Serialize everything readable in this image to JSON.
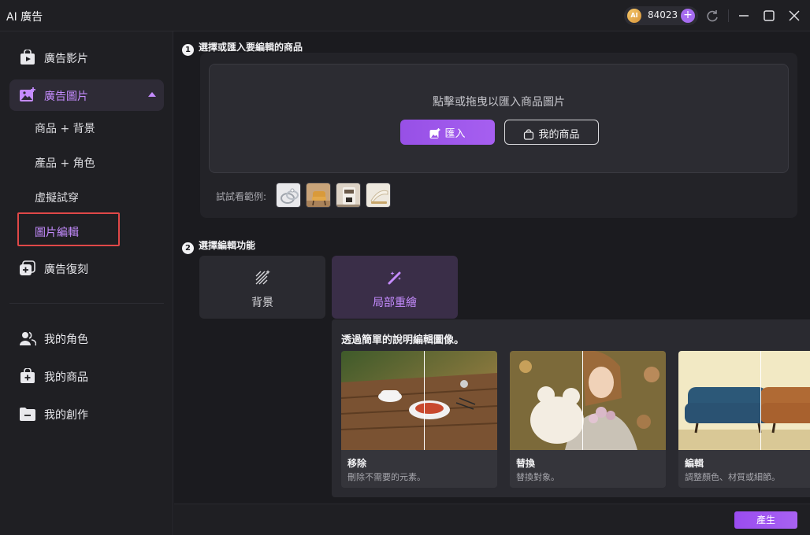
{
  "window": {
    "title": "AI 廣告",
    "credits": "84023",
    "coin_label": "AI"
  },
  "sidebar": {
    "items": [
      {
        "label": "廣告影片",
        "icon": "video-bag-icon"
      },
      {
        "label": "廣告圖片",
        "icon": "image-plus-icon",
        "active": true
      },
      {
        "label": "廣告復刻",
        "icon": "copy-plus-icon"
      },
      {
        "label": "我的角色",
        "icon": "users-icon"
      },
      {
        "label": "我的商品",
        "icon": "shopping-bag-icon"
      },
      {
        "label": "我的創作",
        "icon": "folder-icon"
      }
    ],
    "sub_items": [
      {
        "label": "商品 + 背景"
      },
      {
        "label": "產品 + 角色"
      },
      {
        "label": "虛擬試穿"
      },
      {
        "label": "圖片編輯",
        "selected": true
      }
    ]
  },
  "step1": {
    "number": "1",
    "title": "選擇或匯入要編輯的商品",
    "drop_hint": "點擊或拖曳以匯入商品圖片",
    "import_label": "匯入",
    "my_products_label": "我的商品",
    "examples_label": "試試看範例:"
  },
  "step2": {
    "number": "2",
    "title": "選擇編輯功能",
    "functions": [
      {
        "label": "背景",
        "icon": "hatch-sparkle-icon"
      },
      {
        "label": "局部重繪",
        "icon": "magic-wand-icon",
        "active": true
      }
    ]
  },
  "gallery": {
    "title": "透過簡單的說明編輯圖像。",
    "cards": [
      {
        "title": "移除",
        "desc": "刪除不需要的元素。"
      },
      {
        "title": "替換",
        "desc": "替換對象。"
      },
      {
        "title": "編輯",
        "desc": "調整顏色、材質或細節。"
      }
    ]
  },
  "footer": {
    "generate_label": "產生"
  },
  "colors": {
    "accent": "#a65ff0",
    "accent_text": "#c58cff",
    "highlight_border": "#e04848"
  }
}
